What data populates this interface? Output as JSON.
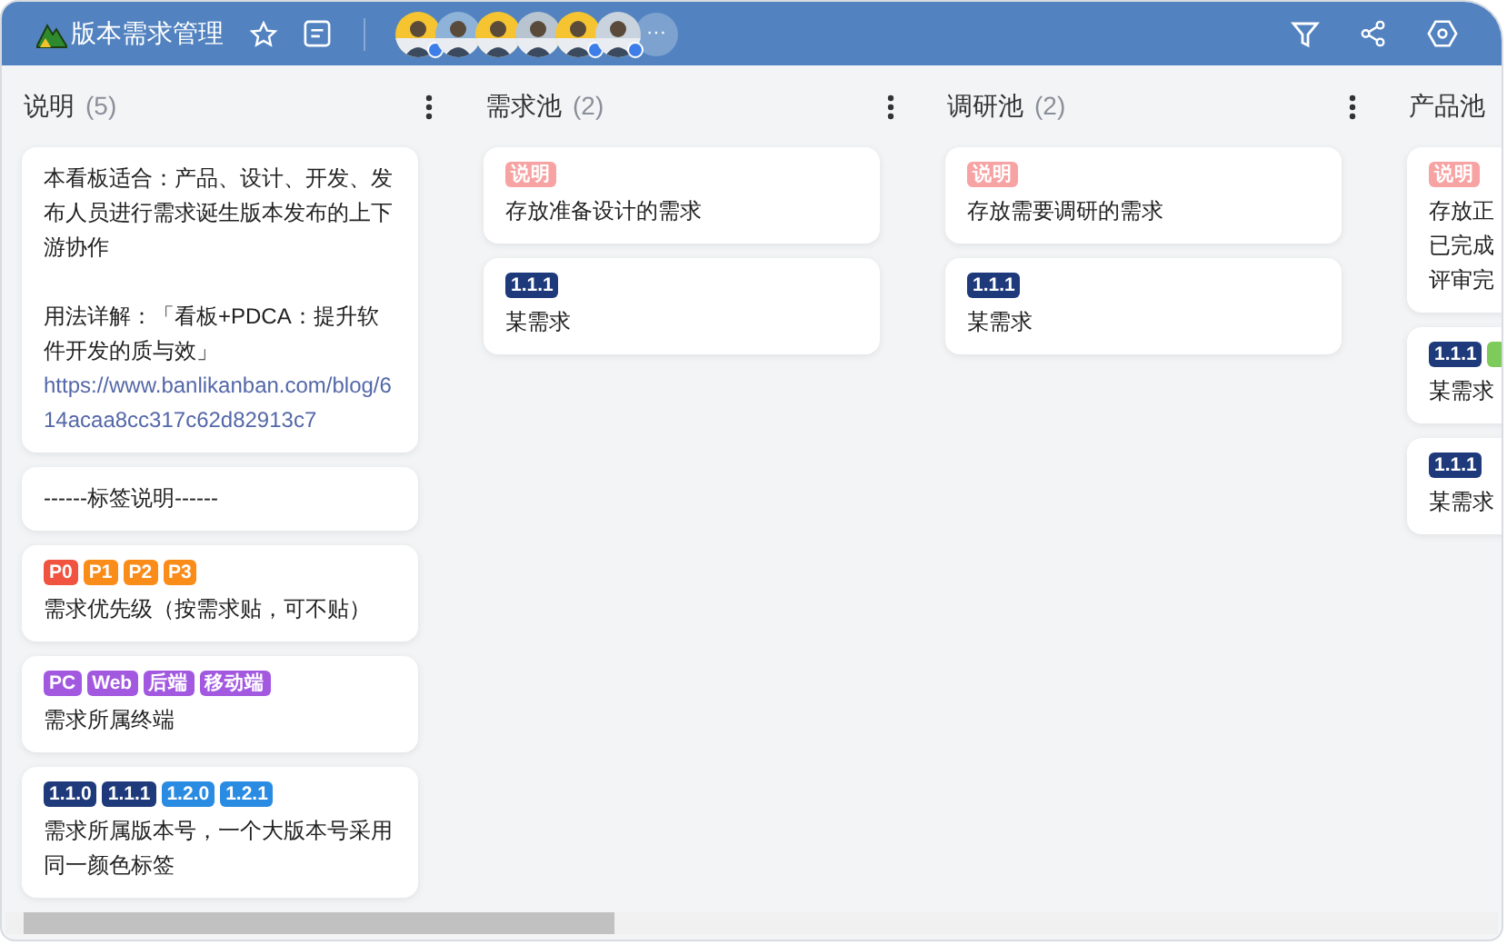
{
  "board": {
    "title": "版本需求管理"
  },
  "members": [
    {
      "kind": "picture",
      "badge": true
    },
    {
      "kind": "picture",
      "badge": false
    },
    {
      "kind": "picture",
      "badge": false
    },
    {
      "kind": "picture",
      "badge": false
    },
    {
      "kind": "picture",
      "badge": true
    },
    {
      "kind": "picture",
      "badge": true
    }
  ],
  "more_members": "···",
  "columns": [
    {
      "title": "说明",
      "count": "(5)",
      "cards": [
        {
          "paragraphs": [
            {
              "text": "本看板适合：产品、设计、开发、发布人员进行需求诞生版本发布的上下游协作"
            },
            {
              "text": "用法详解：「看板+PDCA：提升软件开发的质与效」",
              "link": "https://www.banlikanban.com/blog/614acaa8cc317c62d82913c7"
            }
          ]
        },
        {
          "paragraphs": [
            {
              "text": "------标签说明------"
            }
          ]
        },
        {
          "tags": [
            {
              "label": "P0",
              "color": "#f0533f"
            },
            {
              "label": "P1",
              "color": "#fa8c1a"
            },
            {
              "label": "P2",
              "color": "#fa8c1a"
            },
            {
              "label": "P3",
              "color": "#fa8c1a"
            }
          ],
          "paragraphs": [
            {
              "text": "需求优先级（按需求贴，可不贴）"
            }
          ]
        },
        {
          "tags": [
            {
              "label": "PC",
              "color": "#a259e0"
            },
            {
              "label": "Web",
              "color": "#a259e0"
            },
            {
              "label": "后端",
              "color": "#a259e0"
            },
            {
              "label": "移动端",
              "color": "#a259e0"
            }
          ],
          "paragraphs": [
            {
              "text": "需求所属终端"
            }
          ]
        },
        {
          "tags": [
            {
              "label": "1.1.0",
              "color": "#1e3a7b"
            },
            {
              "label": "1.1.1",
              "color": "#1e3a7b"
            },
            {
              "label": "1.2.0",
              "color": "#2a8be2"
            },
            {
              "label": "1.2.1",
              "color": "#2a8be2"
            }
          ],
          "paragraphs": [
            {
              "text": "需求所属版本号，一个大版本号采用同一颜色标签"
            }
          ]
        }
      ]
    },
    {
      "title": "需求池",
      "count": "(2)",
      "cards": [
        {
          "tags": [
            {
              "label": "说明",
              "color": "#f7a3a3"
            }
          ],
          "paragraphs": [
            {
              "text": "存放准备设计的需求"
            }
          ]
        },
        {
          "tags": [
            {
              "label": "1.1.1",
              "color": "#1e3a7b"
            }
          ],
          "paragraphs": [
            {
              "text": "某需求"
            }
          ]
        }
      ]
    },
    {
      "title": "调研池",
      "count": "(2)",
      "cards": [
        {
          "tags": [
            {
              "label": "说明",
              "color": "#f7a3a3"
            }
          ],
          "paragraphs": [
            {
              "text": "存放需要调研的需求"
            }
          ]
        },
        {
          "tags": [
            {
              "label": "1.1.1",
              "color": "#1e3a7b"
            }
          ],
          "paragraphs": [
            {
              "text": "某需求"
            }
          ]
        }
      ]
    },
    {
      "title": "产品池",
      "cards": [
        {
          "tags": [
            {
              "label": "说明",
              "color": "#f7a3a3"
            }
          ],
          "paragraphs": [
            {
              "text": "存放正"
            },
            {
              "text": "已完成"
            },
            {
              "text": "评审完"
            }
          ]
        },
        {
          "tags": [
            {
              "label": "1.1.1",
              "color": "#1e3a7b"
            },
            {
              "color": "#7ccb5b"
            }
          ],
          "paragraphs": [
            {
              "text": "某需求"
            }
          ]
        },
        {
          "tags": [
            {
              "label": "1.1.1",
              "color": "#1e3a7b"
            }
          ],
          "paragraphs": [
            {
              "text": "某需求"
            }
          ]
        }
      ]
    }
  ]
}
